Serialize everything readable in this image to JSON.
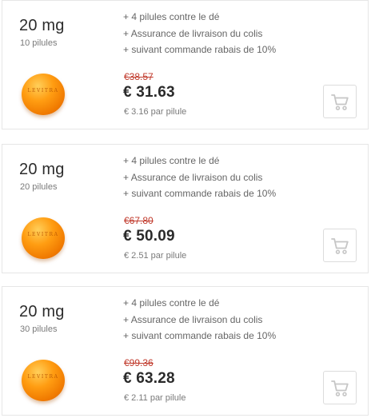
{
  "products": [
    {
      "dose": "20 mg",
      "count": "10 pilules",
      "features": [
        "4 pilules contre le dé",
        "Assurance de livraison du colis",
        "suivant commande rabais de 10%"
      ],
      "old_price": "€38.57",
      "price": "€ 31.63",
      "unit_price": "€ 3.16 par pilule",
      "pill_logo": "LEVITRA"
    },
    {
      "dose": "20 mg",
      "count": "20 pilules",
      "features": [
        "4 pilules contre le dé",
        "Assurance de livraison du colis",
        "suivant commande rabais de 10%"
      ],
      "old_price": "€67.80",
      "price": "€ 50.09",
      "unit_price": "€ 2.51 par pilule",
      "pill_logo": "LEVITRA"
    },
    {
      "dose": "20 mg",
      "count": "30 pilules",
      "features": [
        "4 pilules contre le dé",
        "Assurance de livraison du colis",
        "suivant commande rabais de 10%"
      ],
      "old_price": "€99.36",
      "price": "€ 63.28",
      "unit_price": "€ 2.11 par pilule",
      "pill_logo": "LEVITRA"
    }
  ],
  "colors": {
    "old_price": "#c0392b",
    "pill": "#f07a00",
    "cart_icon": "#c6c6c6",
    "border": "#e6e6e6"
  },
  "icons": {
    "cart": "shopping-cart-icon"
  }
}
